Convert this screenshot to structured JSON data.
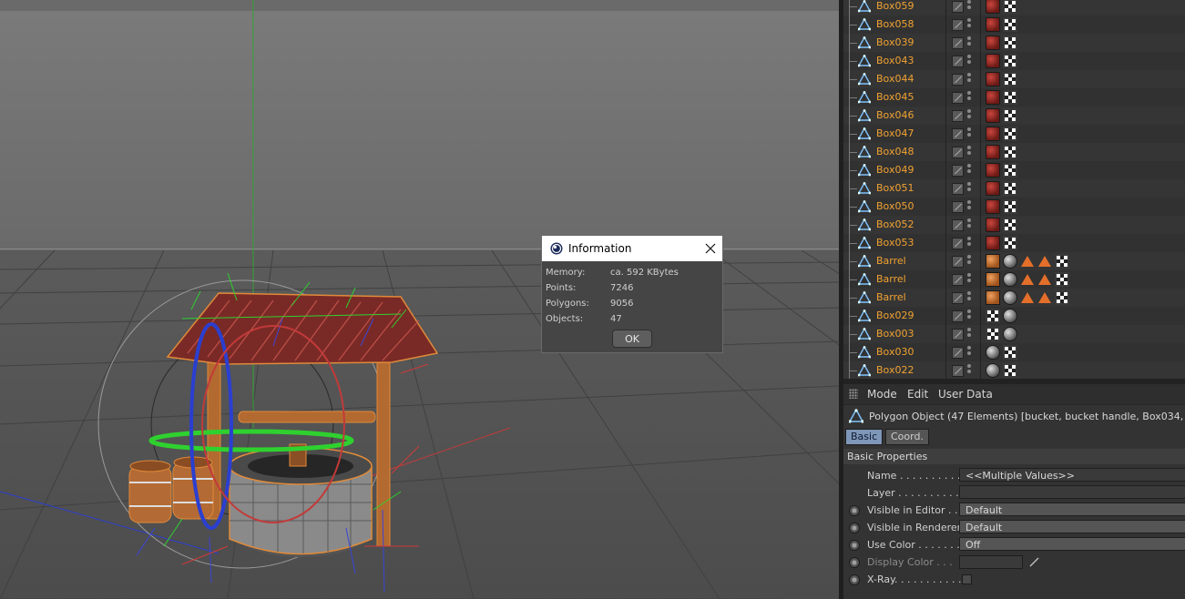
{
  "objects": [
    {
      "name": "Box059",
      "tags": [
        "red",
        "check"
      ]
    },
    {
      "name": "Box058",
      "tags": [
        "red",
        "check"
      ]
    },
    {
      "name": "Box039",
      "tags": [
        "red",
        "check"
      ]
    },
    {
      "name": "Box043",
      "tags": [
        "red",
        "check"
      ]
    },
    {
      "name": "Box044",
      "tags": [
        "red",
        "check"
      ]
    },
    {
      "name": "Box045",
      "tags": [
        "red",
        "check"
      ]
    },
    {
      "name": "Box046",
      "tags": [
        "red",
        "check"
      ]
    },
    {
      "name": "Box047",
      "tags": [
        "red",
        "check"
      ]
    },
    {
      "name": "Box048",
      "tags": [
        "red",
        "check"
      ]
    },
    {
      "name": "Box049",
      "tags": [
        "red",
        "check"
      ]
    },
    {
      "name": "Box051",
      "tags": [
        "red",
        "check"
      ]
    },
    {
      "name": "Box050",
      "tags": [
        "red",
        "check"
      ]
    },
    {
      "name": "Box052",
      "tags": [
        "red",
        "check"
      ]
    },
    {
      "name": "Box053",
      "tags": [
        "red",
        "check"
      ]
    },
    {
      "name": "Barrel",
      "tags": [
        "orange",
        "grey",
        "tri",
        "tri",
        "check"
      ]
    },
    {
      "name": "Barrel",
      "tags": [
        "orange",
        "grey",
        "tri",
        "tri",
        "check"
      ]
    },
    {
      "name": "Barrel",
      "tags": [
        "orange",
        "grey",
        "tri",
        "tri",
        "check"
      ]
    },
    {
      "name": "Box029",
      "tags": [
        "check",
        "grey"
      ]
    },
    {
      "name": "Box003",
      "tags": [
        "check",
        "grey"
      ]
    },
    {
      "name": "Box030",
      "tags": [
        "grey",
        "check"
      ]
    },
    {
      "name": "Box022",
      "tags": [
        "grey",
        "check"
      ]
    }
  ],
  "attributes": {
    "menu": [
      "Mode",
      "Edit",
      "User Data"
    ],
    "title": "Polygon Object (47 Elements) [bucket, bucket handle, Box034, Box03",
    "tabs": [
      "Basic",
      "Coord."
    ],
    "active_tab": "Basic",
    "section": "Basic Properties",
    "properties": [
      {
        "label": "Name . . . . . . . . . . . . .",
        "value": "<<Multiple Values>>",
        "kind": "text",
        "radio": false
      },
      {
        "label": "Layer . . . . . . . . . . . .",
        "value": "",
        "kind": "text",
        "radio": false
      },
      {
        "label": "Visible in Editor . . .",
        "value": "Default",
        "kind": "dropdown",
        "radio": true
      },
      {
        "label": "Visible in Renderer",
        "value": "Default",
        "kind": "dropdown",
        "radio": true
      },
      {
        "label": "Use Color . . . . . . . .",
        "value": "Off",
        "kind": "dropdown",
        "radio": true
      },
      {
        "label": "Display Color . . .",
        "value": "",
        "kind": "color",
        "radio": true,
        "dim": true
      },
      {
        "label": "X-Ray. . . . . . . . . . . .",
        "value": "",
        "kind": "checkbox",
        "radio": true
      }
    ]
  },
  "dialog": {
    "title": "Information",
    "rows": [
      {
        "label": "Memory:",
        "value": "ca. 592 KBytes"
      },
      {
        "label": "Points:",
        "value": "7246"
      },
      {
        "label": "Polygons:",
        "value": "9056"
      },
      {
        "label": "Objects:",
        "value": "47"
      }
    ],
    "ok_label": "OK"
  },
  "colors": {
    "object_name": "#f0a232",
    "viewport_bg": "#6e6e6e",
    "active_tab": "#7e96b8"
  }
}
